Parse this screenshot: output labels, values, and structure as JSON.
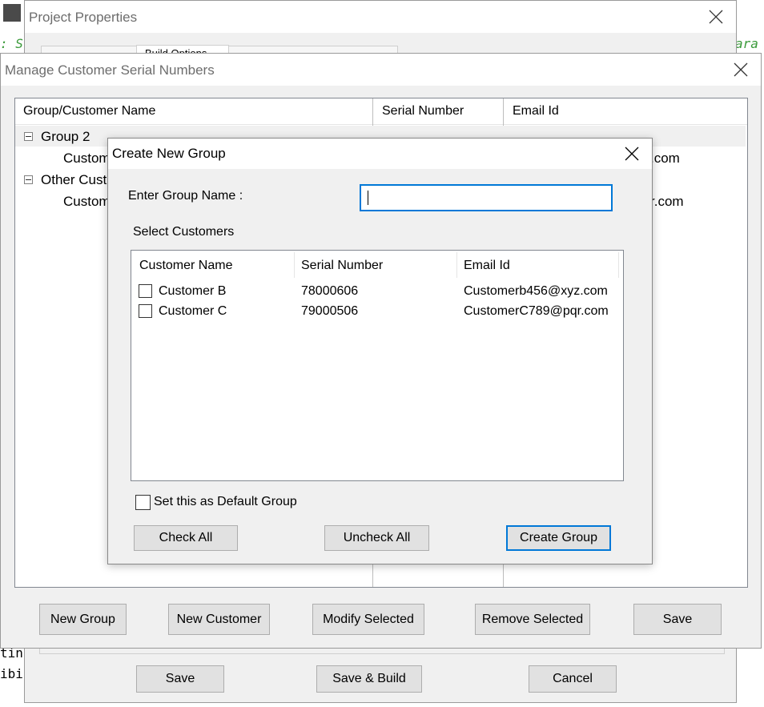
{
  "background_code": {
    "frag_left_top": ": S",
    "frag_right_top": "ara",
    "frag_left_1": "tin",
    "frag_left_2": "ibi"
  },
  "project_properties": {
    "title": "Project Properties",
    "tab_partial": "Build Options",
    "buttons": {
      "save": "Save",
      "save_build": "Save & Build",
      "cancel": "Cancel"
    }
  },
  "manage_window": {
    "title": "Manage Customer Serial Numbers",
    "columns": [
      "Group/Customer Name",
      "Serial Number",
      "Email Id"
    ],
    "tree": [
      {
        "group": "Group 2",
        "child_name": "Customer A",
        "child_email_tail": ".com"
      },
      {
        "group": "Other Customers",
        "child_name": "Customer D",
        "child_email_tail": "r.com"
      }
    ],
    "buttons": {
      "new_group": "New Group",
      "new_customer": "New Customer",
      "modify_selected": "Modify Selected",
      "remove_selected": "Remove Selected",
      "save": "Save"
    }
  },
  "create_group_dialog": {
    "title": "Create New Group",
    "group_name_label": "Enter Group Name :",
    "group_name_value": "",
    "select_customers_label": "Select Customers",
    "columns": [
      "Customer Name",
      "Serial Number",
      "Email Id"
    ],
    "customers": [
      {
        "name": "Customer B",
        "serial": "78000606",
        "email": "Customerb456@xyz.com",
        "checked": false
      },
      {
        "name": "Customer C",
        "serial": "79000506",
        "email": "CustomerC789@pqr.com",
        "checked": false
      }
    ],
    "default_group_label": "Set this as Default Group",
    "buttons": {
      "check_all": "Check All",
      "uncheck_all": "Uncheck All",
      "create_group": "Create Group"
    }
  },
  "colors": {
    "accent": "#0078d7",
    "dialog_bg": "#f0f0f0",
    "button_bg": "#e1e1e1"
  }
}
